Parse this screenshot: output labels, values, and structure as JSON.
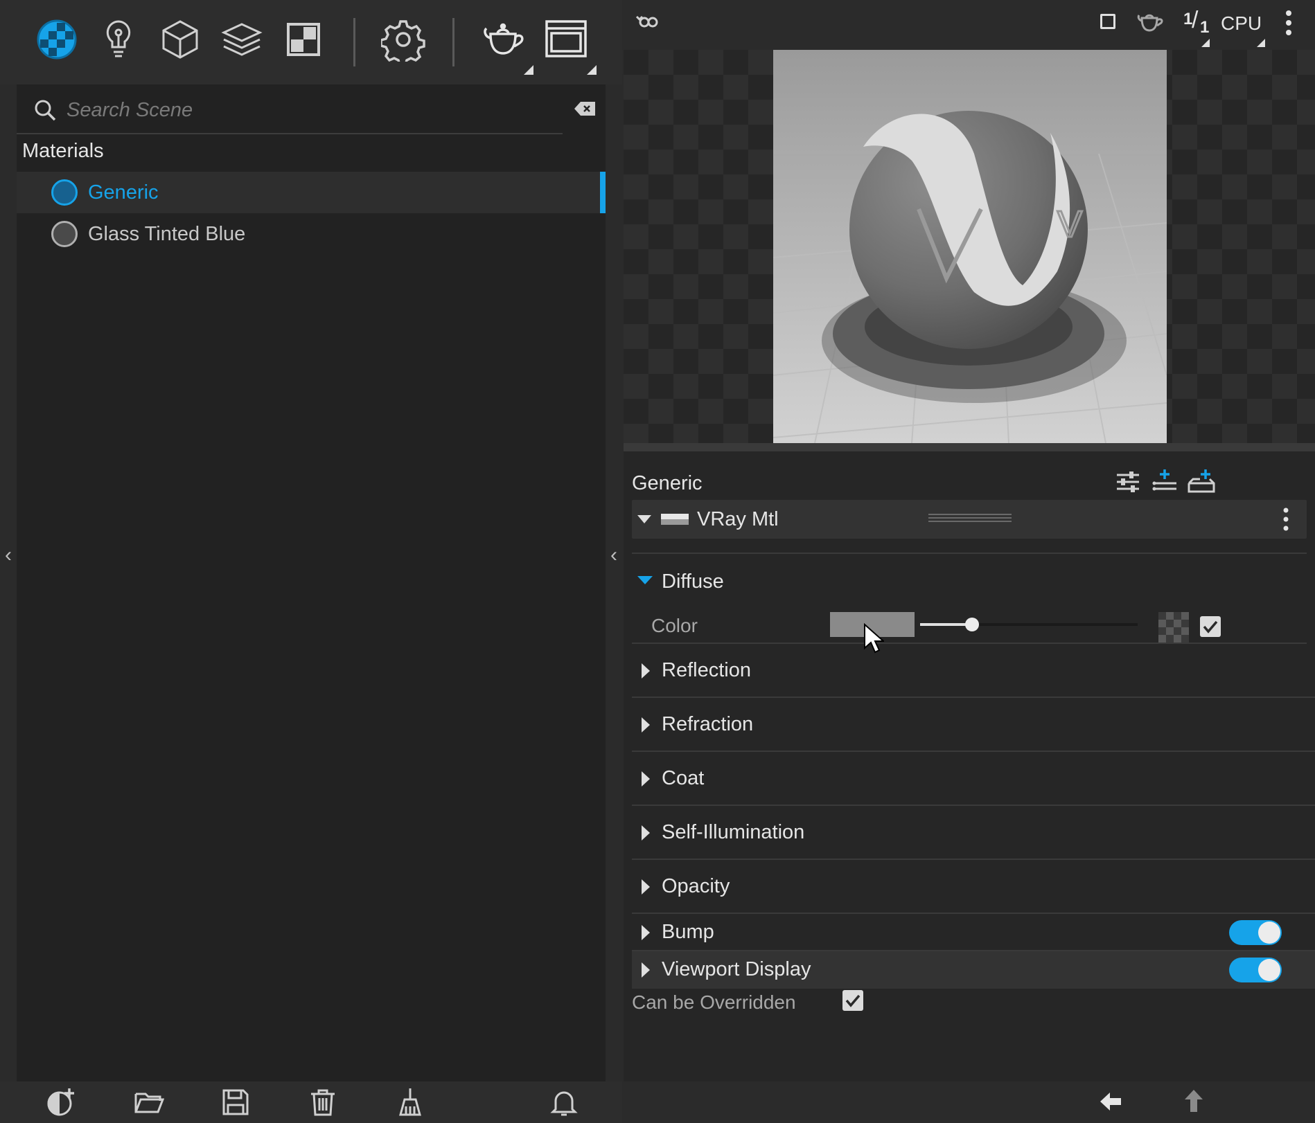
{
  "search": {
    "placeholder": "Search Scene"
  },
  "materials": {
    "header": "Materials",
    "items": [
      {
        "label": "Generic",
        "selected": true,
        "color": "#16a3e9"
      },
      {
        "label": "Glass Tinted Blue",
        "selected": false,
        "color": "#c8c8c8"
      }
    ]
  },
  "viewport": {
    "fraction_top": "1",
    "fraction_bottom": "1",
    "engine": "CPU",
    "render_logo": "V"
  },
  "properties": {
    "material_name": "Generic",
    "mtl_type": "VRay Mtl",
    "diffuse": {
      "label": "Diffuse",
      "color_label": "Color",
      "color_value": "#8a8a8a",
      "slider_fraction": 0.24,
      "enabled": true
    },
    "sections": [
      {
        "label": "Reflection"
      },
      {
        "label": "Refraction"
      },
      {
        "label": "Coat"
      },
      {
        "label": "Self-Illumination"
      },
      {
        "label": "Opacity"
      },
      {
        "label": "Bump",
        "toggle": true
      },
      {
        "label": "Viewport Display",
        "toggle": true
      }
    ],
    "override_label": "Can be Overridden",
    "override_checked": true
  },
  "theme": {
    "accent": "#16a3e9"
  }
}
